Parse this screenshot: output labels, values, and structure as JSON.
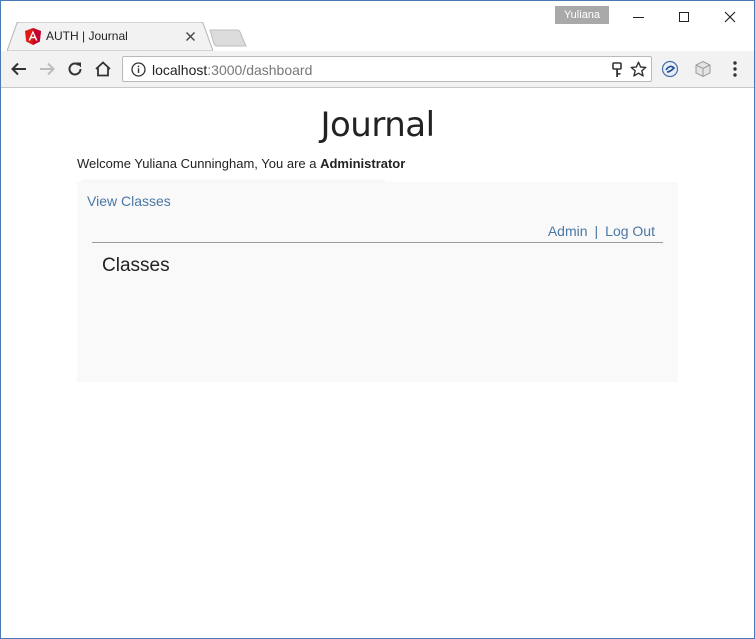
{
  "browser": {
    "profile_name": "Yuliana",
    "tab": {
      "title": "AUTH | Journal",
      "favicon": "angular-icon"
    },
    "url": {
      "host": "localhost",
      "path": ":3000/dashboard"
    },
    "icons": {
      "back": "arrow-left-icon",
      "forward": "arrow-right-icon",
      "reload": "reload-icon",
      "home": "home-icon",
      "info": "info-icon",
      "key": "key-icon",
      "star": "star-icon",
      "menu": "more-vert-icon"
    }
  },
  "page": {
    "app_title": "Journal",
    "welcome_prefix": "Welcome Yuliana Cunningham, You are a ",
    "role": "Administrator",
    "nav": {
      "view_classes": "View Classes",
      "admin": "Admin",
      "separator": "|",
      "logout": "Log Out"
    },
    "section_title": "Classes"
  },
  "colors": {
    "link": "#4a77a3",
    "panel_bg": "#f9f9f9",
    "window_border": "#4a7ab5",
    "angular_red": "#dd1b16"
  }
}
